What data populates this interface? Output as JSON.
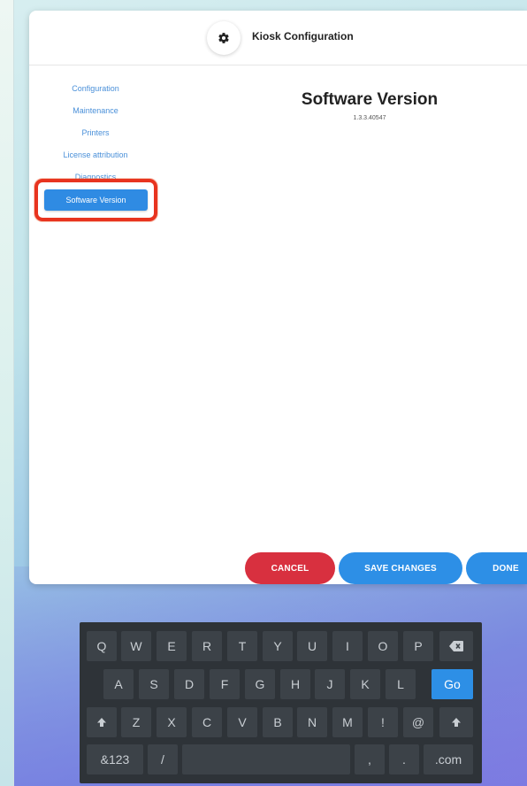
{
  "header": {
    "title": "Kiosk Configuration",
    "icon": "gear-icon"
  },
  "sidebar": {
    "items": [
      {
        "label": "Configuration"
      },
      {
        "label": "Maintenance"
      },
      {
        "label": "Printers"
      },
      {
        "label": "License attribution"
      },
      {
        "label": "Diagnostics"
      }
    ],
    "active": {
      "label": "Software Version"
    }
  },
  "main": {
    "title": "Software Version",
    "version": "1.3.3.40547"
  },
  "buttons": {
    "cancel": "CANCEL",
    "save": "SAVE CHANGES",
    "done": "DONE"
  },
  "keyboard": {
    "row1": [
      "Q",
      "W",
      "E",
      "R",
      "T",
      "Y",
      "U",
      "I",
      "O",
      "P"
    ],
    "backspace_icon": "backspace-icon",
    "row2": [
      "A",
      "S",
      "D",
      "F",
      "G",
      "H",
      "J",
      "K",
      "L"
    ],
    "go": "Go",
    "shift_icon": "shift-up-icon",
    "row3": [
      "Z",
      "X",
      "C",
      "V",
      "B",
      "N",
      "M",
      "!",
      "@"
    ],
    "row4": {
      "numbers": "&123",
      "slash": "/",
      "comma": ",",
      "period": ".",
      "dotcom": ".com"
    }
  },
  "colors": {
    "accent": "#2d8fe6",
    "cancel": "#d8303f",
    "highlight": "#e8341f",
    "keyboard_bg": "#2e3338"
  }
}
